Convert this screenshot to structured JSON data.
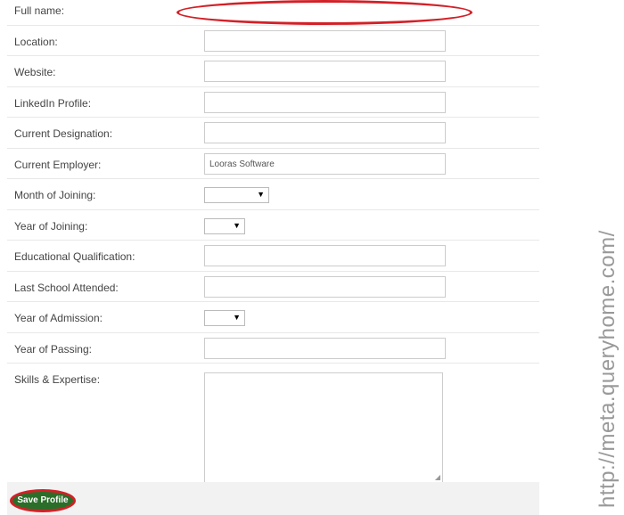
{
  "fields": [
    {
      "label": "Full name:",
      "type": "text",
      "value": ""
    },
    {
      "label": "Location:",
      "type": "text",
      "value": ""
    },
    {
      "label": "Website:",
      "type": "text",
      "value": ""
    },
    {
      "label": "LinkedIn Profile:",
      "type": "text",
      "value": ""
    },
    {
      "label": "Current Designation:",
      "type": "text",
      "value": ""
    },
    {
      "label": "Current Employer:",
      "type": "text",
      "value": "Looras Software"
    },
    {
      "label": "Month of Joining:",
      "type": "select",
      "value": ""
    },
    {
      "label": "Year of Joining:",
      "type": "select",
      "value": ""
    },
    {
      "label": "Educational Qualification:",
      "type": "text",
      "value": ""
    },
    {
      "label": "Last School Attended:",
      "type": "text",
      "value": ""
    },
    {
      "label": "Year of Admission:",
      "type": "select",
      "value": ""
    },
    {
      "label": "Year of Passing:",
      "type": "text",
      "value": ""
    }
  ],
  "skills": {
    "label": "Skills & Expertise:",
    "value": ""
  },
  "save_button": "Save Profile",
  "dropdown_arrow": "▼",
  "watermark": "http://meta.queryhome.com/",
  "colors": {
    "button": "#2a6e2a",
    "highlight": "#d32027"
  }
}
